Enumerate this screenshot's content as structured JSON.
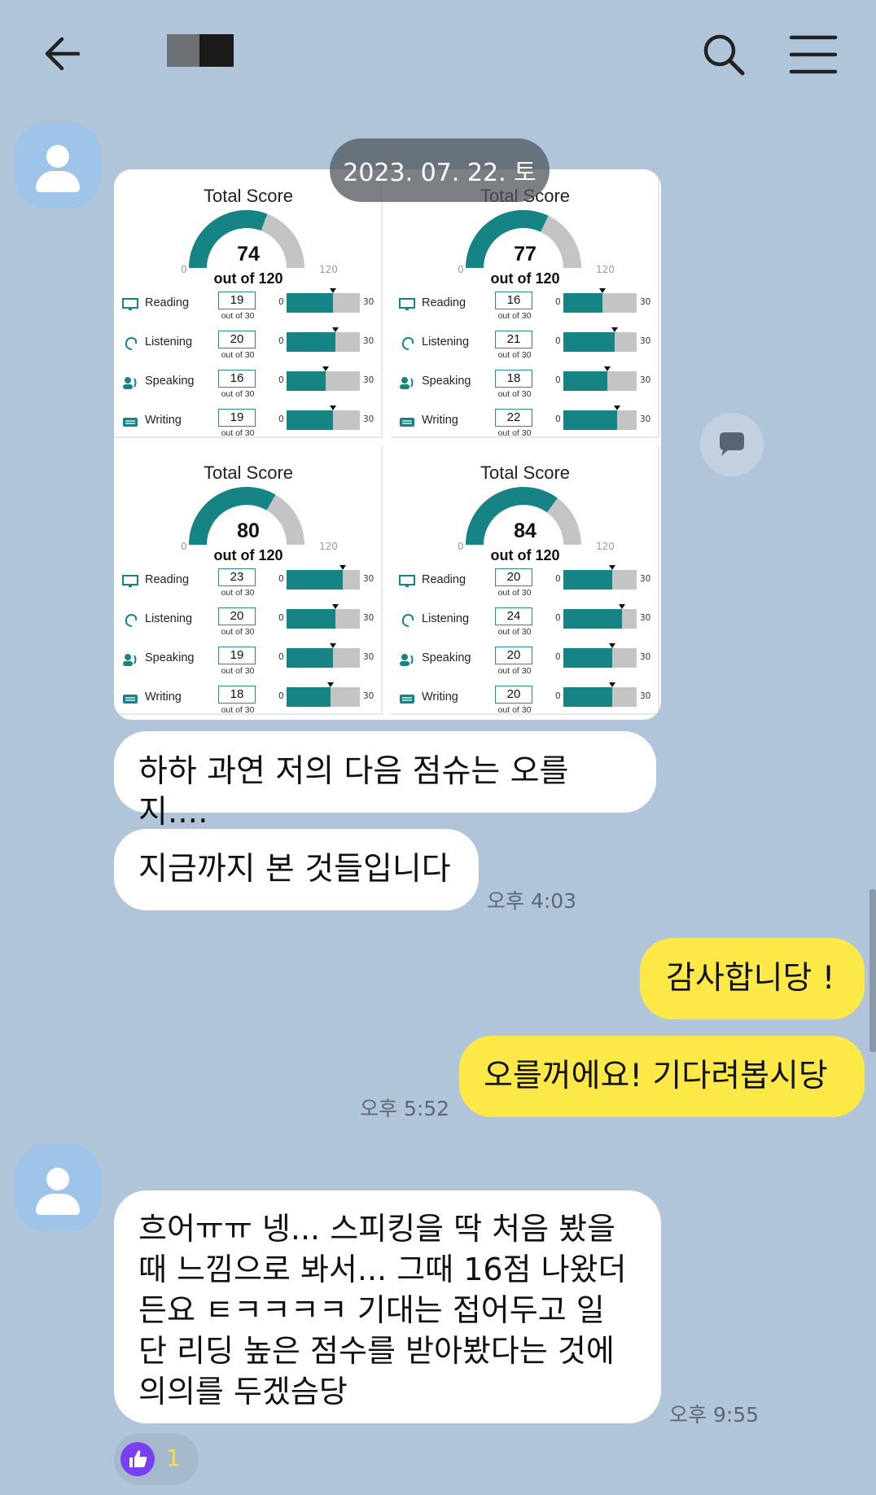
{
  "header": {
    "back_icon": "back-arrow-icon",
    "search_icon": "search-icon",
    "menu_icon": "menu-icon"
  },
  "date_divider": "2023. 07. 22. 토",
  "score_image": {
    "title": "Total Score",
    "out_of": "out of 120",
    "range_min": "0",
    "range_max": "120",
    "section_out_of": "out of 30",
    "bar_min": "0",
    "bar_max": "30",
    "labels": {
      "reading": "Reading",
      "listening": "Listening",
      "speaking": "Speaking",
      "writing": "Writing"
    },
    "panels": [
      {
        "total": "74",
        "reading": "19",
        "listening": "20",
        "speaking": "16",
        "writing": "19"
      },
      {
        "total": "77",
        "reading": "16",
        "listening": "21",
        "speaking": "18",
        "writing": "22"
      },
      {
        "total": "80",
        "reading": "23",
        "listening": "20",
        "speaking": "19",
        "writing": "18"
      },
      {
        "total": "84",
        "reading": "20",
        "listening": "24",
        "speaking": "20",
        "writing": "20"
      }
    ]
  },
  "messages": {
    "m1": "하하 과연 저의 다음 점슈는 오를지....",
    "m2": "지금까지 본 것들입니다",
    "t1": "오후 4:03",
    "m3": "감사합니당 !",
    "m4": "오를꺼에요! 기다려봅시당",
    "t2": "오후 5:52",
    "m5_l1": "흐어ㅠㅠ 넹... 스피킹을 딱 처음 봤을",
    "m5_l2": "때 느낌으로 봐서... 그때 16점 나왔더",
    "m5_l3": "든요 ㅌㅋㅋㅋㅋ 기대는 접어두고 일",
    "m5_l4": "단 리딩 높은 점수를 받아봤다는 것에",
    "m5_l5": "의의를 두겠슴당",
    "t3": "오후 9:55"
  },
  "reaction": {
    "icon": "thumbs-up-icon",
    "count": "1"
  },
  "colors": {
    "background": "#b1c5da",
    "yellow_bubble": "#fce948",
    "score_teal": "#168484"
  }
}
